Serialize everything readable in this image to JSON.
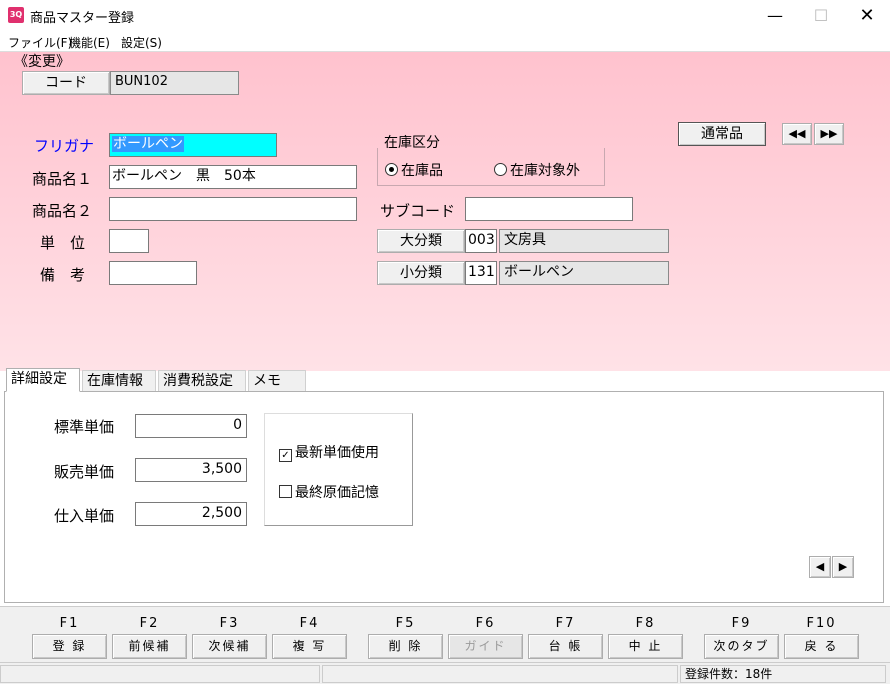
{
  "window": {
    "app_icon_text": "3Q",
    "title": "商品マスター登録"
  },
  "menu": [
    "ファイル(F)",
    "機能(E)",
    "設定(S)"
  ],
  "mode_label": "《変更》",
  "code": {
    "label": "コード",
    "value": "BUN102"
  },
  "product_type_button": "通常品",
  "form": {
    "furigana": {
      "label": "フリガナ",
      "value": "ボールペン"
    },
    "name1": {
      "label": "商品名１",
      "value": "ボールペン　黒　50本"
    },
    "name2": {
      "label": "商品名２",
      "value": ""
    },
    "unit": {
      "label": "単　位",
      "value": ""
    },
    "remarks": {
      "label": "備　考",
      "value": ""
    }
  },
  "stock_group": {
    "title": "在庫区分",
    "options": [
      "在庫品",
      "在庫対象外"
    ],
    "selected": "在庫品"
  },
  "sub_code": {
    "label": "サブコード",
    "value": ""
  },
  "major_category": {
    "label": "大分類",
    "code": "003",
    "name": "文房具"
  },
  "minor_category": {
    "label": "小分類",
    "code": "131",
    "name": "ボールペン"
  },
  "tabs": [
    "詳細設定",
    "在庫情報",
    "消費税設定",
    "メモ"
  ],
  "active_tab": "詳細設定",
  "details": {
    "standard_price": {
      "label": "標準単価",
      "value": "0"
    },
    "sales_price": {
      "label": "販売単価",
      "value": "3,500"
    },
    "purchase_price": {
      "label": "仕入単価",
      "value": "2,500"
    },
    "use_latest_price": {
      "label": "最新単価使用",
      "checked": true
    },
    "remember_cost": {
      "label": "最終原価記憶",
      "checked": false
    }
  },
  "function_keys": [
    {
      "key": "F1",
      "label": "登 録",
      "enabled": true
    },
    {
      "key": "F2",
      "label": "前候補",
      "enabled": true
    },
    {
      "key": "F3",
      "label": "次候補",
      "enabled": true
    },
    {
      "key": "F4",
      "label": "複 写",
      "enabled": true
    },
    {
      "key": "F5",
      "label": "削 除",
      "enabled": true
    },
    {
      "key": "F6",
      "label": "ガイド",
      "enabled": false
    },
    {
      "key": "F7",
      "label": "台 帳",
      "enabled": true
    },
    {
      "key": "F8",
      "label": "中 止",
      "enabled": true
    },
    {
      "key": "F9",
      "label": "次のタブ",
      "enabled": true
    },
    {
      "key": "F10",
      "label": "戻 る",
      "enabled": true
    }
  ],
  "status": {
    "record_count": "登録件数：18件"
  },
  "colors": {
    "accent_pink": "#ffc2ce",
    "selection_cyan": "#00ffff",
    "furigana_label": "#0000ff"
  }
}
